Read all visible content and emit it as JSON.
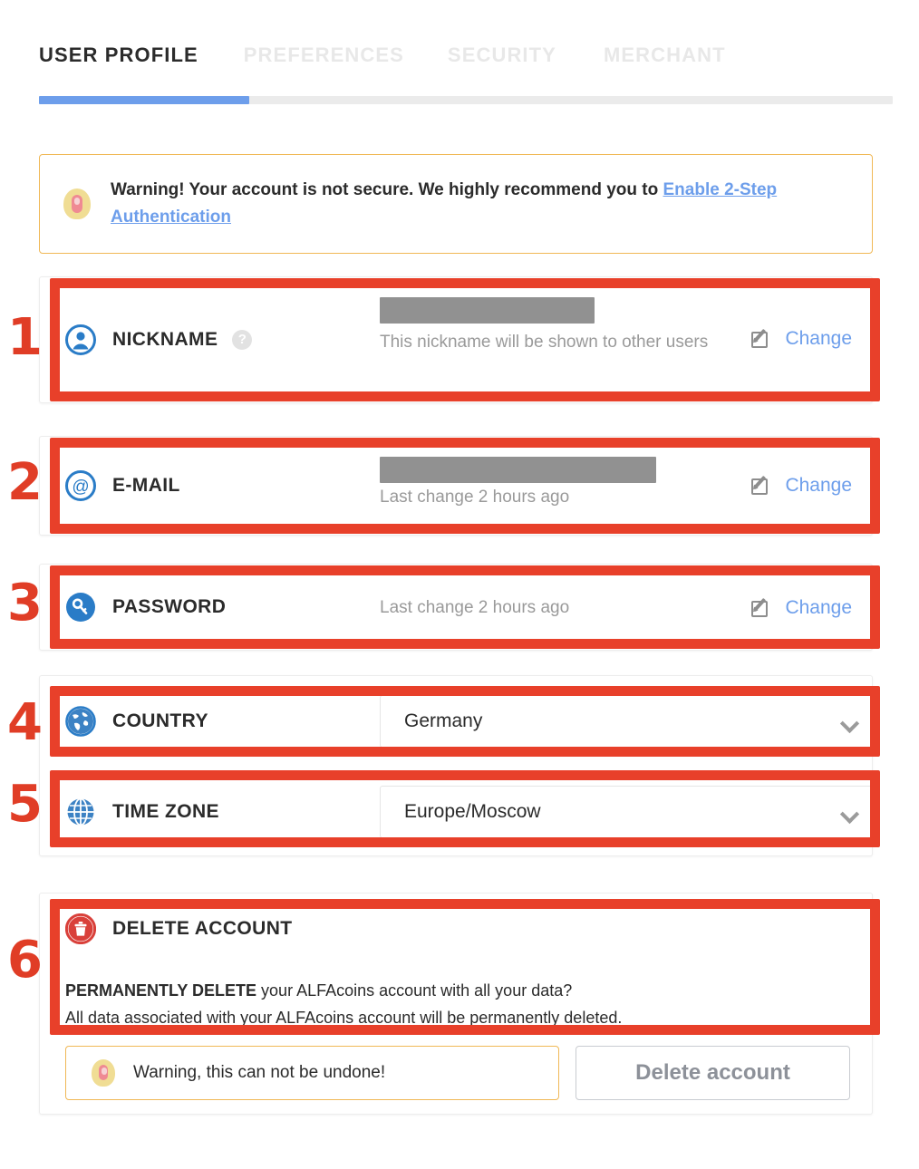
{
  "tabs": [
    {
      "label": "USER PROFILE",
      "active": true
    },
    {
      "label": "PREFERENCES",
      "active": false
    },
    {
      "label": "SECURITY",
      "active": false
    },
    {
      "label": "MERCHANT",
      "active": false
    }
  ],
  "warning_banner": {
    "icon": "warning-bulb-icon",
    "text_before": "Warning! Your account is not secure. We highly recommend you to ",
    "link_text": "Enable 2-Step Authentication"
  },
  "rows": {
    "nickname": {
      "icon": "user-circle-icon",
      "label": "NICKNAME",
      "help_icon": "question-mark-icon",
      "help_glyph": "?",
      "value_redacted": true,
      "description": "This nickname will be shown to other users",
      "action_icon": "edit-pencil-icon",
      "action_label": "Change"
    },
    "email": {
      "icon": "at-sign-circle-icon",
      "label": "E-MAIL",
      "value_redacted": true,
      "description": "Last change 2 hours ago",
      "action_icon": "edit-pencil-icon",
      "action_label": "Change"
    },
    "password": {
      "icon": "key-circle-icon",
      "label": "PASSWORD",
      "description": "Last change 2 hours ago",
      "action_icon": "edit-pencil-icon",
      "action_label": "Change"
    },
    "country": {
      "icon": "globe-earth-icon",
      "label": "COUNTRY",
      "selected": "Germany",
      "chevron_icon": "chevron-down-icon"
    },
    "timezone": {
      "icon": "globe-meridian-icon",
      "label": "TIME ZONE",
      "selected": "Europe/Moscow",
      "chevron_icon": "chevron-down-icon"
    }
  },
  "delete_account": {
    "icon": "trash-circle-icon",
    "title": "DELETE ACCOUNT",
    "body_bold": "PERMANENTLY DELETE",
    "body_line1_rest": " your ALFAcoins account with all your data?",
    "body_line2": "All data associated with your ALFAcoins account will be permanently deleted.",
    "warning_icon": "warning-bulb-icon",
    "warning_text": "Warning, this can not be undone!",
    "button_label": "Delete account"
  },
  "annotations": {
    "numbers": [
      "1",
      "2",
      "3",
      "4",
      "5",
      "6"
    ]
  },
  "colors": {
    "accent_blue": "#6d9eeb",
    "annotation_red": "#e8402a",
    "warning_border": "#f0b856",
    "redaction_gray": "#919191",
    "delete_red": "#d9403a"
  }
}
